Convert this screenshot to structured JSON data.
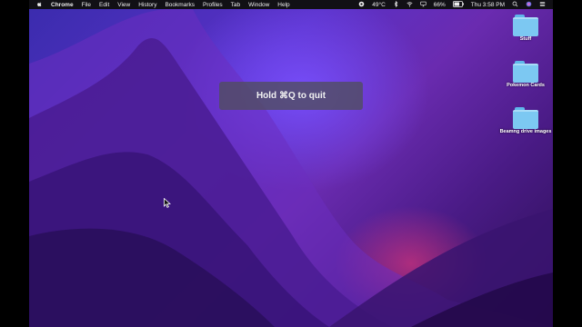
{
  "menubar": {
    "app_name": "Chrome",
    "menus": [
      "File",
      "Edit",
      "View",
      "History",
      "Bookmarks",
      "Profiles",
      "Tab",
      "Window",
      "Help"
    ],
    "temperature": "49°C",
    "battery": "66%",
    "clock": "Thu 3:58 PM",
    "icons": [
      "apple-icon",
      "status-circle-icon",
      "bluetooth-icon",
      "wifi-icon",
      "airplay-icon",
      "battery-icon",
      "search-icon",
      "siri-icon",
      "control-center-icon"
    ]
  },
  "hud": {
    "message": "Hold ⌘Q to quit"
  },
  "desktop_icons": [
    {
      "label": "Stuff",
      "icon": "folder-icon"
    },
    {
      "label": "Pokemon Cards",
      "icon": "folder-icon"
    },
    {
      "label": "Beamng drive images",
      "icon": "folder-icon"
    }
  ],
  "colors": {
    "folder": "#7cc8f2",
    "wallpaper_primary": "#5a31c7",
    "wallpaper_shadow": "#2b0f55",
    "hud_bg": "#504e5c"
  }
}
